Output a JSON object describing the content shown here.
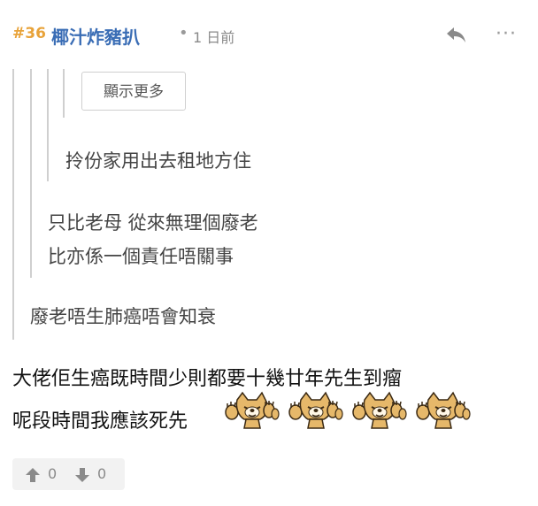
{
  "header": {
    "post_number": "#36",
    "username": "椰汁炸豬扒",
    "separator": "•",
    "time": "1 日前",
    "more": "···"
  },
  "quote": {
    "show_more_label": "顯示更多",
    "level3": "拎份家用出去租地方住",
    "level2_line1": "只比老母 從來無理個廢老",
    "level2_line2": "比亦係一個責任唔關事",
    "level1": "廢老唔生肺癌唔會知衰"
  },
  "body": {
    "line1": "大佬佢生癌既時間少則都要十幾廿年先生到瘤",
    "line2": "呢段時間我應該死先"
  },
  "emojis": [
    "dog-clapping-icon",
    "dog-clapping-icon",
    "dog-clapping-icon",
    "dog-clapping-icon"
  ],
  "votes": {
    "up": "0",
    "down": "0"
  },
  "colors": {
    "post_number": "#e8a33a",
    "username": "#3a6db5",
    "quote_bar": "#cfcfcf"
  }
}
